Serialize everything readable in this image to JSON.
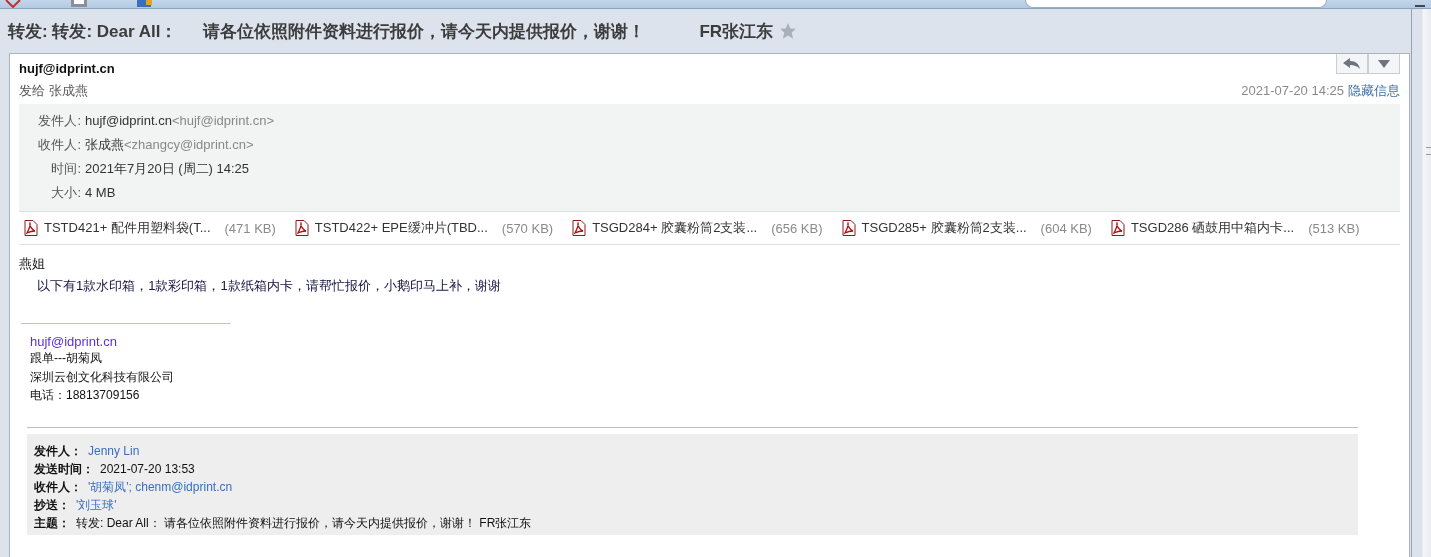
{
  "subject": {
    "parts": [
      "转发: 转发: Dear All：",
      "请各位依照附件资料进行报价，请今天内提供报价，谢谢！",
      "FR张江东"
    ],
    "starred": false
  },
  "header": {
    "sender": "hujf@idprint.cn",
    "to_line": "发给 张成燕",
    "date": "2021-07-20 14:25",
    "toggle": "隐藏信息"
  },
  "details": [
    {
      "label": "发件人:",
      "name": "hujf@idprint.cn",
      "address": "<hujf@idprint.cn>"
    },
    {
      "label": "收件人:",
      "name": "张成燕",
      "address": "<zhangcy@idprint.cn>"
    },
    {
      "label": "时间:",
      "name": "2021年7月20日 (周二) 14:25"
    },
    {
      "label": "大小:",
      "name": "4 MB"
    }
  ],
  "attachments": [
    {
      "name": "TSTD421+ 配件用塑料袋(T...",
      "size": "(471 KB)"
    },
    {
      "name": "TSTD422+ EPE缓冲片(TBD...",
      "size": "(570 KB)"
    },
    {
      "name": "TSGD284+ 胶囊粉筒2支装...",
      "size": "(656 KB)"
    },
    {
      "name": "TSGD285+ 胶囊粉筒2支装...",
      "size": "(604 KB)"
    },
    {
      "name": "TSGD286 硒鼓用中箱内卡...",
      "size": "(513 KB)"
    }
  ],
  "body": {
    "greeting": "燕姐",
    "text": "以下有1款水印箱，1款彩印箱，1款纸箱内卡，请帮忙报价，小鹅印马上补，谢谢"
  },
  "signature": {
    "email": "hujf@idprint.cn",
    "lines": [
      "跟单---胡菊凤",
      "深圳云创文化科技有限公司",
      "电话：18813709156"
    ]
  },
  "quoted": [
    {
      "label": "发件人：",
      "value": "Jenny Lin",
      "kind": "link"
    },
    {
      "label": "发送时间：",
      "value": "2021-07-20 13:53",
      "kind": "plain"
    },
    {
      "label": "收件人：",
      "value": "'胡菊凤'; chenm@idprint.cn",
      "kind": "link"
    },
    {
      "label": "抄送：",
      "value": "'刘玉球'",
      "kind": "link"
    },
    {
      "label": "主题：",
      "value": "转发: Dear All：  请各位依照附件资料进行报价，请今天内提供报价，谢谢！  FR张江东",
      "kind": "plain"
    }
  ]
}
